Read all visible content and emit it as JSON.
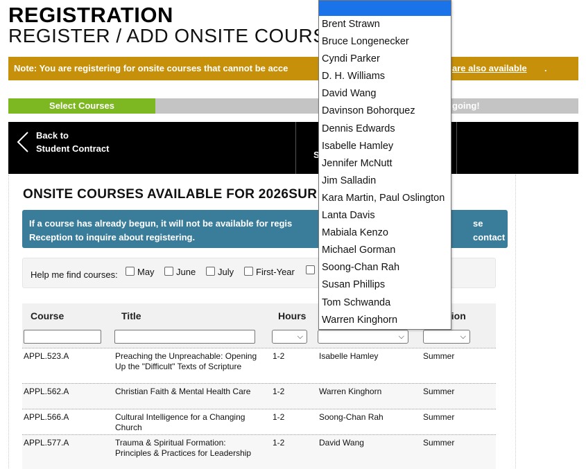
{
  "header": {
    "title": "REGISTRATION",
    "subtitle": "REGISTER / ADD ONSITE COURSES"
  },
  "note": {
    "text": "Note: You are registering for onsite courses that cannot be acce",
    "link_text": "are also available",
    "tail": "."
  },
  "progress": {
    "step1_label": "Select Courses",
    "step_end_fragment": "going!"
  },
  "nav": {
    "back_line1": "Back to",
    "back_line2": "Student Contract",
    "mid_fragment": "S"
  },
  "main": {
    "heading": "ONSITE COURSES AVAILABLE FOR 2026SUR",
    "info_line1": "If a course has already begun, it will not be available for regis",
    "info_line2": "Reception to inquire about registering.",
    "info_right_fragment": "se contact"
  },
  "filters": {
    "label": "Help me find courses:",
    "options": [
      "May",
      "June",
      "July",
      "First-Year"
    ]
  },
  "table": {
    "headers": [
      "Course",
      "Title",
      "Hours",
      "",
      "sion"
    ],
    "rows": [
      {
        "course": "APPL.523.A",
        "title": "Preaching the Unpreachable: Opening Up the \"Difficult\" Texts of Scripture",
        "hours": "1-2",
        "faculty": "Isabelle Hamley",
        "session": "Summer"
      },
      {
        "course": "APPL.562.A",
        "title": "Christian Faith & Mental Health Care",
        "hours": "1-2",
        "faculty": "Warren Kinghorn",
        "session": "Summer"
      },
      {
        "course": "APPL.566.A",
        "title": "Cultural Intelligence for a Changing Church",
        "hours": "1-2",
        "faculty": "Soong-Chan Rah",
        "session": "Summer"
      },
      {
        "course": "APPL.577.A",
        "title": "Trauma & Spiritual Formation: Principles & Practices for Leadership",
        "hours": "1-2",
        "faculty": "David Wang",
        "session": "Summer"
      }
    ]
  },
  "faculty_dropdown": {
    "options": [
      "Brent Strawn",
      "Bruce Longenecker",
      "Cyndi Parker",
      "D. H. Williams",
      "David Wang",
      "Davinson Bohorquez",
      "Dennis Edwards",
      "Isabelle Hamley",
      "Jennifer McNutt",
      "Jim Salladin",
      "Kara Martin, Paul Oslington",
      "Lanta Davis",
      "Mabiala Kenzo",
      "Michael Gorman",
      "Soong-Chan Rah",
      "Susan Phillips",
      "Tom Schwanda",
      "Warren Kinghorn"
    ]
  },
  "colors": {
    "note_bg": "#c6900a",
    "progress_active": "#7db823",
    "info_bg": "#3a7d9a",
    "dropdown_selected": "#1a73e8"
  }
}
